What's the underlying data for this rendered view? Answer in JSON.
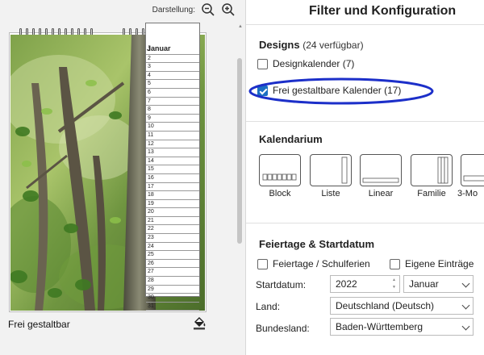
{
  "preview": {
    "view_label": "Darstellung:",
    "zoom_out_icon": "zoom-out-icon",
    "zoom_in_icon": "zoom-in-icon",
    "month": "Januar",
    "days": [
      "1",
      "2",
      "3",
      "4",
      "5",
      "6",
      "7",
      "8",
      "9",
      "10",
      "11",
      "12",
      "13",
      "14",
      "15",
      "16",
      "17",
      "18",
      "19",
      "20",
      "21",
      "22",
      "23",
      "24",
      "25",
      "26",
      "27",
      "28",
      "29",
      "30",
      "31"
    ],
    "caption": "Frei gestaltbar",
    "fill_icon": "paint-bucket-icon"
  },
  "panel": {
    "title": "Filter und Konfiguration"
  },
  "designs": {
    "title": "Designs",
    "available": "(24 verfügbar)",
    "options": [
      {
        "label": "Designkalender (7)",
        "checked": false
      },
      {
        "label": "Frei gestaltbare Kalender (17)",
        "checked": true
      }
    ],
    "highlight_color": "#1c2fc9"
  },
  "kalendarium": {
    "title": "Kalendarium",
    "options": [
      "Block",
      "Liste",
      "Linear",
      "Familie",
      "3-Mo"
    ]
  },
  "feiertage": {
    "title": "Feiertage & Startdatum",
    "holidays_label": "Feiertage / Schulferien",
    "own_entries_label": "Eigene Einträge",
    "start_label": "Startdatum:",
    "start_year": "2022",
    "start_month": "Januar",
    "country_label": "Land:",
    "country_value": "Deutschland (Deutsch)",
    "state_label": "Bundesland:",
    "state_value": "Baden-Württemberg"
  },
  "colors": {
    "accent": "#1b6ec2",
    "highlight": "#1c2fc9"
  }
}
